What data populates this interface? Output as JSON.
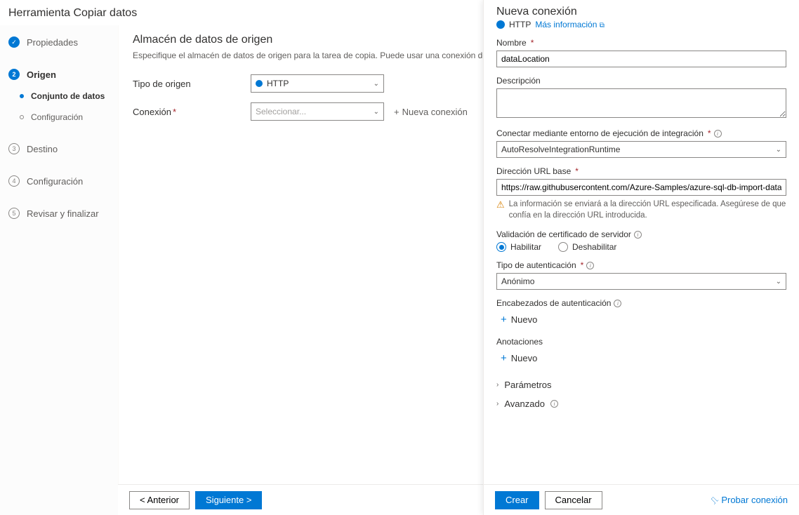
{
  "page_title": "Herramienta Copiar datos",
  "steps": {
    "properties": "Propiedades",
    "source": "Origen",
    "dataset": "Conjunto de datos",
    "configuration": "Configuración",
    "destination": "Destino",
    "config2": "Configuración",
    "review": "Revisar y finalizar",
    "num3": "3",
    "num4": "4",
    "num5": "5"
  },
  "content": {
    "heading": "Almacén de datos de origen",
    "desc": "Especifique el almacén de datos de origen para la tarea de copia. Puede usar una conexión de almacén de datos e",
    "source_type_label": "Tipo de origen",
    "source_type_value": "HTTP",
    "connection_label": "Conexión",
    "connection_placeholder": "Seleccionar...",
    "new_connection": "Nueva conexión"
  },
  "footer": {
    "prev": "< Anterior",
    "next": "Siguiente >"
  },
  "panel": {
    "title": "Nueva conexión",
    "type": "HTTP",
    "more_info": "Más información",
    "name_label": "Nombre",
    "name_value": "dataLocation",
    "desc_label": "Descripción",
    "runtime_label": "Conectar mediante entorno de ejecución de integración",
    "runtime_value": "AutoResolveIntegrationRuntime",
    "base_url_label": "Dirección URL base",
    "base_url_value": "https://raw.githubusercontent.com/Azure-Samples/azure-sql-db-import-data/main/json/user",
    "url_warning": "La información se enviará a la dirección URL especificada. Asegúrese de que confía en la dirección URL introducida.",
    "cert_label": "Validación de certificado de servidor",
    "cert_enable": "Habilitar",
    "cert_disable": "Deshabilitar",
    "auth_type_label": "Tipo de autenticación",
    "auth_type_value": "Anónimo",
    "auth_headers_label": "Encabezados de autenticación",
    "add_new": "Nuevo",
    "annotations_label": "Anotaciones",
    "parameters": "Parámetros",
    "advanced": "Avanzado",
    "create_btn": "Crear",
    "cancel_btn": "Cancelar",
    "test_connection": "Probar conexión"
  }
}
